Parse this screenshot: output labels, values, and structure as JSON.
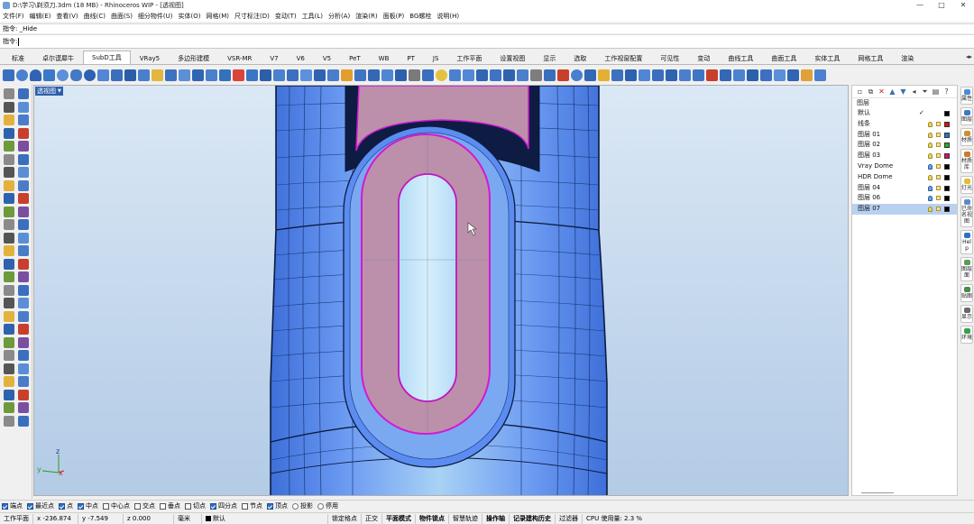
{
  "window": {
    "title": "D:\\学习\\剃须刀.3dm (18 MB) - Rhinoceros WIP - [透视图]",
    "controls": [
      "—",
      "□",
      "✕"
    ]
  },
  "menus": [
    "文件(F)",
    "编辑(E)",
    "查看(V)",
    "曲线(C)",
    "曲面(S)",
    "细分物件(U)",
    "实体(O)",
    "网格(M)",
    "尺寸标注(D)",
    "变动(T)",
    "工具(L)",
    "分析(A)",
    "渲染(R)",
    "面板(P)",
    "BG螺栓",
    "说明(H)"
  ],
  "command": {
    "history": "指令: _Hide",
    "prompt": "指令:",
    "value": ""
  },
  "tabs": [
    {
      "label": "标准",
      "active": false
    },
    {
      "label": "卓尔谟犀牛",
      "active": false
    },
    {
      "label": "SubD工具",
      "active": true
    },
    {
      "label": "VRay5",
      "active": false
    },
    {
      "label": "多边形建模",
      "active": false
    },
    {
      "label": "VSR-MR",
      "active": false
    },
    {
      "label": "V7",
      "active": false
    },
    {
      "label": "V6",
      "active": false
    },
    {
      "label": "V5",
      "active": false
    },
    {
      "label": "PeT",
      "active": false
    },
    {
      "label": "WB",
      "active": false
    },
    {
      "label": "PT",
      "active": false
    },
    {
      "label": "JS",
      "active": false
    },
    {
      "label": "工作平面",
      "active": false
    },
    {
      "label": "设置视图",
      "active": false
    },
    {
      "label": "显示",
      "active": false
    },
    {
      "label": "选取",
      "active": false
    },
    {
      "label": "工作视窗配置",
      "active": false
    },
    {
      "label": "可见性",
      "active": false
    },
    {
      "label": "变动",
      "active": false
    },
    {
      "label": "曲线工具",
      "active": false
    },
    {
      "label": "曲面工具",
      "active": false
    },
    {
      "label": "实体工具",
      "active": false
    },
    {
      "label": "网格工具",
      "active": false
    },
    {
      "label": "渲染",
      "active": false
    }
  ],
  "tab_scroll_icon": "scroll-arrows-icon",
  "viewport": {
    "label": "透视图",
    "axis_x": "x",
    "axis_y": "y",
    "axis_z": "z"
  },
  "layers": {
    "header": "图层",
    "rows": [
      {
        "name": "默认",
        "current": "✓",
        "color": "#000000",
        "bulb": "none",
        "selected": false
      },
      {
        "name": "线条",
        "current": "",
        "color": "#e01010",
        "bulb": "yellow",
        "selected": false
      },
      {
        "name": "图层 01",
        "current": "",
        "color": "#1f78d8",
        "bulb": "yellow",
        "selected": false
      },
      {
        "name": "图层 02",
        "current": "",
        "color": "#20b020",
        "bulb": "yellow",
        "selected": false
      },
      {
        "name": "图层 03",
        "current": "",
        "color": "#d8106a",
        "bulb": "yellow",
        "selected": false
      },
      {
        "name": "Vray Dome",
        "current": "",
        "color": "#000000",
        "bulb": "blue",
        "selected": false
      },
      {
        "name": "HDR Dome",
        "current": "",
        "color": "#000000",
        "bulb": "yellow",
        "selected": false
      },
      {
        "name": "图层 04",
        "current": "",
        "color": "#000000",
        "bulb": "blue",
        "selected": false
      },
      {
        "name": "图层 06",
        "current": "",
        "color": "#000000",
        "bulb": "blue",
        "selected": false
      },
      {
        "name": "图层 07",
        "current": "",
        "color": "#000000",
        "bulb": "yellow",
        "selected": true
      }
    ]
  },
  "side_tabs": [
    {
      "label": "属性",
      "icon_color": "#4a8bd6"
    },
    {
      "label": "图层",
      "icon_color": "#3b78c8"
    },
    {
      "label": "材质",
      "icon_color": "#d0902a"
    },
    {
      "label": "材质库",
      "icon_color": "#c87c2a"
    },
    {
      "label": "灯光",
      "icon_color": "#e0c030"
    },
    {
      "label": "已命名视图",
      "icon_color": "#5a8ad0"
    },
    {
      "label": "Help",
      "icon_color": "#3070c0"
    },
    {
      "label": "图层面",
      "icon_color": "#5a9a5a"
    },
    {
      "label": "贴图",
      "icon_color": "#4a8a4a"
    },
    {
      "label": "显示",
      "icon_color": "#6a6a6a"
    },
    {
      "label": "环境",
      "icon_color": "#3aa04a"
    }
  ],
  "osnaps": [
    {
      "label": "端点",
      "checked": true,
      "type": "check"
    },
    {
      "label": "最近点",
      "checked": true,
      "type": "check"
    },
    {
      "label": "点",
      "checked": true,
      "type": "check"
    },
    {
      "label": "中点",
      "checked": true,
      "type": "check"
    },
    {
      "label": "中心点",
      "checked": false,
      "type": "check"
    },
    {
      "label": "交点",
      "checked": false,
      "type": "check"
    },
    {
      "label": "垂点",
      "checked": false,
      "type": "check"
    },
    {
      "label": "切点",
      "checked": false,
      "type": "check"
    },
    {
      "label": "四分点",
      "checked": true,
      "type": "check"
    },
    {
      "label": "节点",
      "checked": false,
      "type": "check"
    },
    {
      "label": "顶点",
      "checked": true,
      "type": "check"
    },
    {
      "label": "投影",
      "checked": false,
      "type": "radio"
    },
    {
      "label": "停用",
      "checked": false,
      "type": "radio"
    }
  ],
  "status": {
    "cplane": "工作平面",
    "x": "x -236.874",
    "y": "y -7.549",
    "z": "z 0.000",
    "unit": "毫米",
    "layer": "默认",
    "grid_snap": "锁定格点",
    "ortho": "正交",
    "planar": "平面模式",
    "osnap": "物件锁点",
    "smart_track": "智慧轨迹",
    "gumball": "操作轴",
    "history": "记录建构历史",
    "filter": "过滤器",
    "cpu": "CPU 使用量: 2.3 %"
  },
  "colors": {
    "model_blue": "#5b8cf0",
    "model_light": "#a9d2f4",
    "inset_pink": "#bc90aa",
    "selection_magenta": "#d418d4",
    "active_tab_bg": "#ffffff",
    "selected_layer_bg": "#b9d1f0"
  }
}
